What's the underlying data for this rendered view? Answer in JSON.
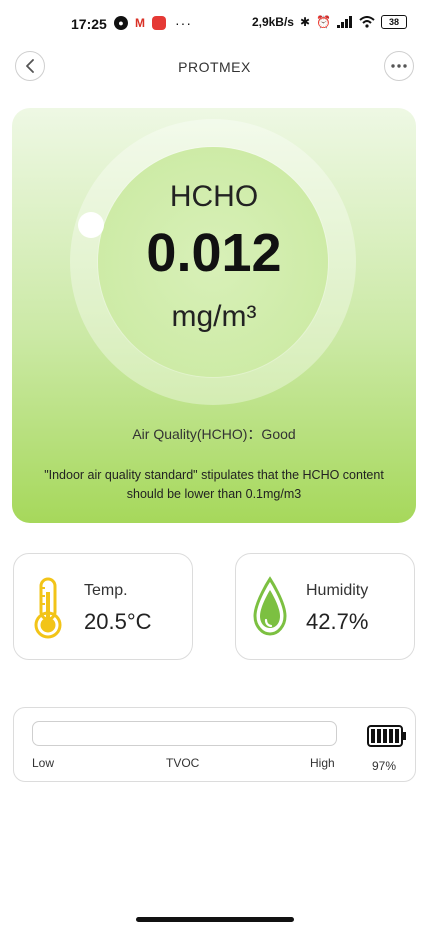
{
  "status_bar": {
    "time": "17:25",
    "speed": "2,9kB/s",
    "battery": "38",
    "more": "···"
  },
  "header": {
    "title": "PROTMEX"
  },
  "main": {
    "gas_name": "HCHO",
    "gas_value": "0.012",
    "gas_unit": "mg/m³",
    "air_quality": "Air Quality(HCHO)：Good",
    "standard_note": "\"Indoor air quality standard\" stipulates that the HCHO content should be lower than 0.1mg/m3",
    "accent_color": "#a6d85b"
  },
  "temperature": {
    "label": "Temp.",
    "value": "20.5°C",
    "icon": "thermometer-icon",
    "color": "#f2c418"
  },
  "humidity": {
    "label": "Humidity",
    "value": "42.7%",
    "icon": "water-drop-icon",
    "color": "#7cc041"
  },
  "tvoc": {
    "low_label": "Low",
    "name": "TVOC",
    "high_label": "High",
    "battery_percent": "97%",
    "battery_level": 0.97
  }
}
